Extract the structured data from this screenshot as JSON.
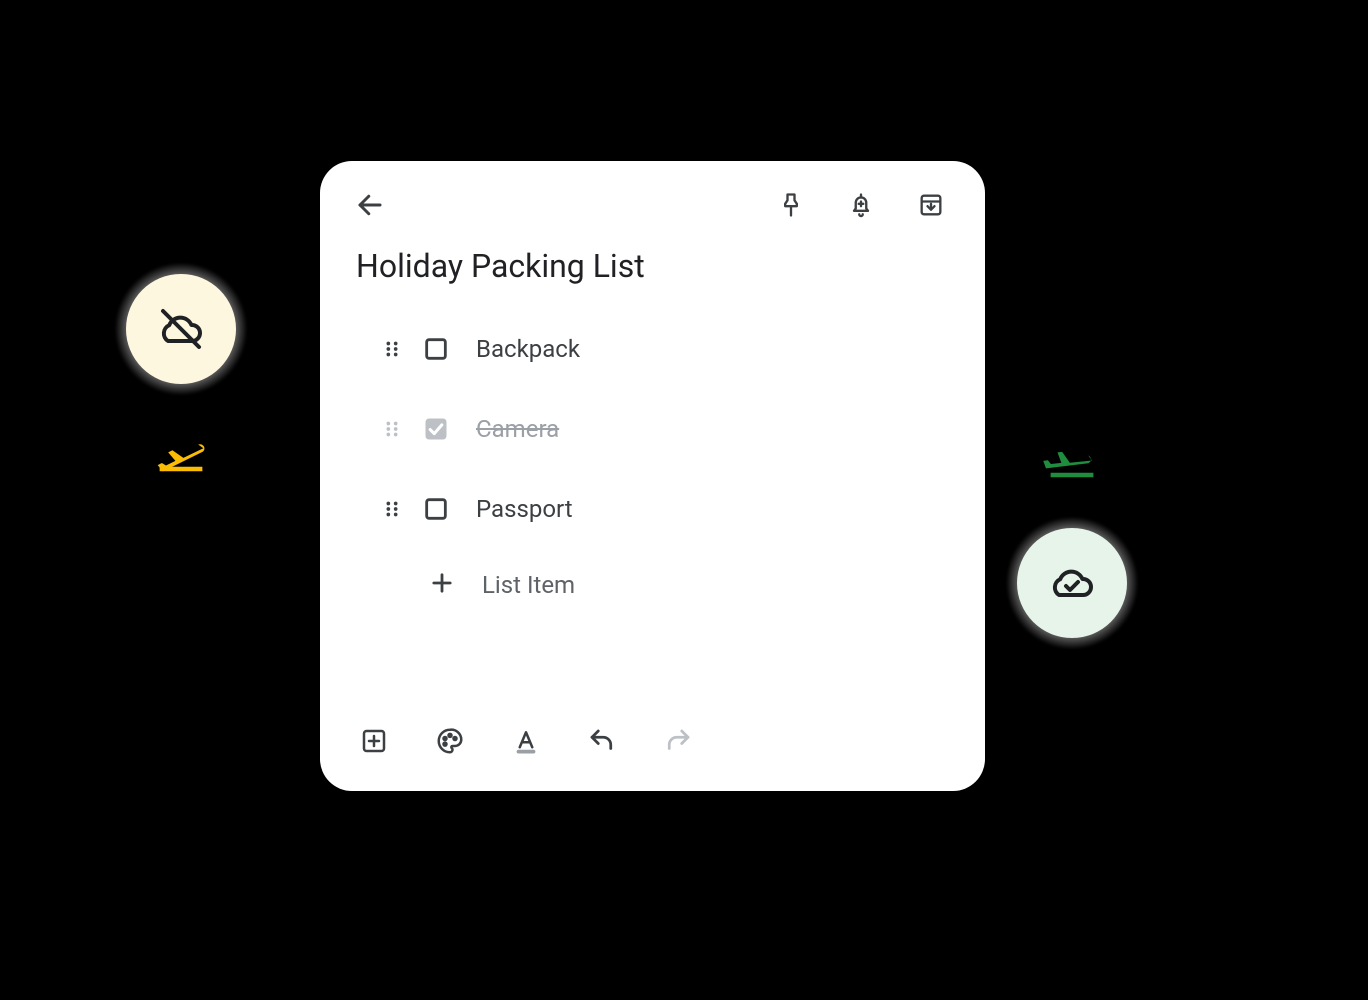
{
  "note": {
    "title": "Holiday Packing List",
    "add_placeholder": "List Item",
    "items": [
      {
        "label": "Backpack",
        "done": false
      },
      {
        "label": "Camera",
        "done": true
      },
      {
        "label": "Passport",
        "done": false
      }
    ]
  },
  "topbar": {
    "back": "back",
    "pin": "pin",
    "reminder": "reminder",
    "archive": "archive"
  },
  "bottombar": {
    "add": "add",
    "palette": "palette",
    "text_format": "text-format",
    "undo": "undo",
    "redo": "redo"
  },
  "floating": {
    "left": {
      "status": "cloud-off",
      "plane": "takeoff"
    },
    "right": {
      "status": "cloud-done",
      "plane": "landing"
    }
  }
}
